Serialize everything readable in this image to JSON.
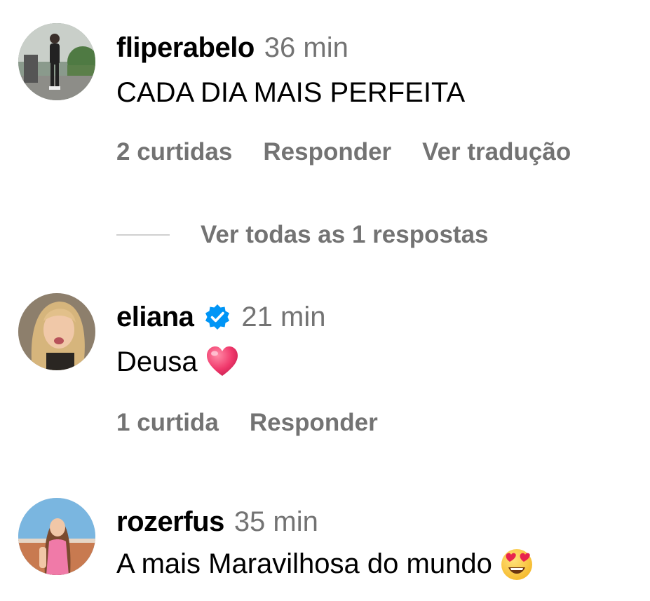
{
  "comments": [
    {
      "username": "fliperabelo",
      "time": "36 min",
      "text": "CADA DIA MAIS PERFEITA",
      "likes": "2 curtidas",
      "reply": "Responder",
      "translate": "Ver tradução",
      "view_replies": "Ver todas as 1 respostas",
      "avatar_icon": "avatar-photo"
    },
    {
      "username": "eliana",
      "verified": true,
      "time": "21 min",
      "text": "Deusa",
      "emoji": "red-heart-emoji",
      "likes": "1 curtida",
      "reply": "Responder",
      "avatar_icon": "avatar-photo"
    },
    {
      "username": "rozerfus",
      "time": "35 min",
      "text": "A mais Maravilhosa do mundo",
      "emoji": "heart-eyes-emoji",
      "avatar_icon": "avatar-photo"
    }
  ],
  "colors": {
    "secondary_text": "#737373",
    "verified_blue": "#0095f6",
    "heart_red": "#f0386b"
  }
}
